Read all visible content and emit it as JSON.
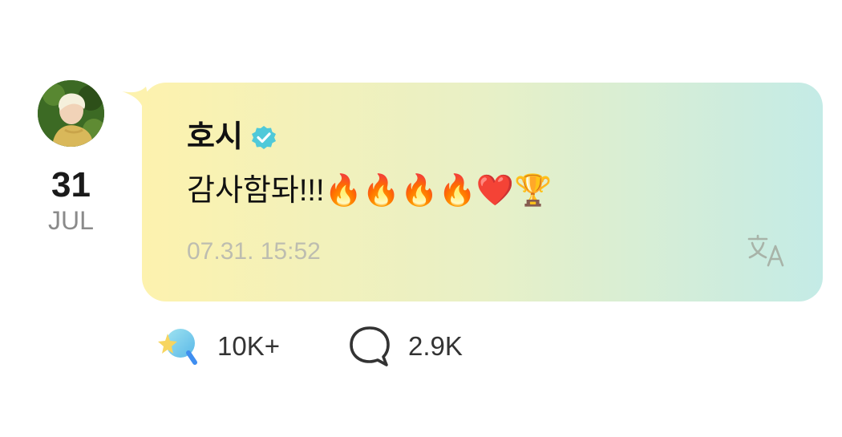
{
  "post": {
    "date": {
      "day": "31",
      "month": "JUL"
    },
    "author": {
      "name": "호시",
      "verified": true
    },
    "message": "감사함돠!!!🔥🔥🔥🔥❤️🏆",
    "timestamp": "07.31. 15:52",
    "icons": {
      "avatar": "profile-photo",
      "verified": "verified-check-icon",
      "translate": "translate-icon",
      "like": "sparkle-like-icon",
      "comment": "speech-bubble-icon"
    }
  },
  "stats": {
    "likes": "10K+",
    "comments": "2.9K"
  },
  "colors": {
    "bubble_left": "#fdf2ae",
    "bubble_right": "#c4ebe6",
    "verified": "#4fc9d9",
    "timestamp": "#bdbdb0"
  }
}
